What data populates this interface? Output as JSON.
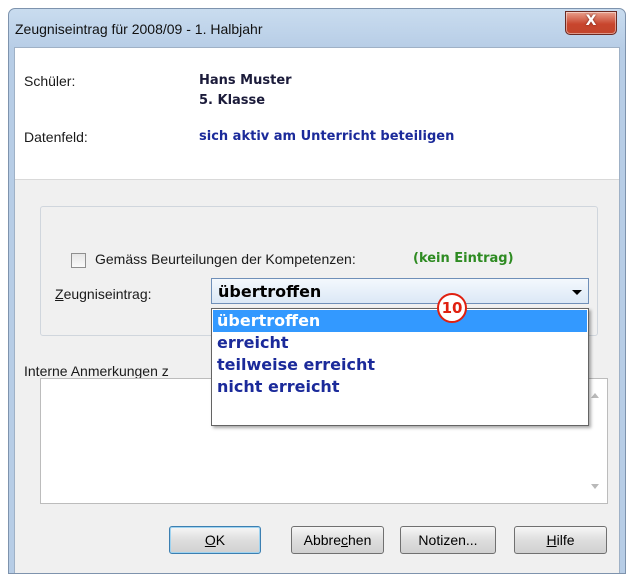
{
  "window": {
    "title": "Zeugniseintrag für 2008/09 - 1. Halbjahr",
    "close_glyph": "X"
  },
  "info": {
    "student_label": "Schüler:",
    "student_name": "Hans Muster",
    "student_class": "5. Klasse",
    "field_label": "Datenfeld:",
    "field_value": "sich aktiv am Unterricht beteiligen"
  },
  "form": {
    "competency_checkbox_label": "Gemäss Beurteilungen der Kompetenzen:",
    "competency_checked": false,
    "competency_status": "(kein Eintrag)",
    "entry_label": "Zeugniseintrag:",
    "entry_value": "übertroffen",
    "options": [
      "übertroffen",
      "erreicht",
      "teilweise erreicht",
      "nicht erreicht"
    ],
    "selected_option_index": 0
  },
  "notes": {
    "label": "Interne Anmerkungen z",
    "value": ""
  },
  "annotation_badge": "10",
  "buttons": {
    "ok": "OK",
    "cancel": "Abbrechen",
    "notes": "Notizen...",
    "help": "Hilfe"
  },
  "colors": {
    "selection": "#3399ff",
    "option_text": "#1b2a9a",
    "status_green": "#2e8b22",
    "badge_red": "#e02010"
  }
}
